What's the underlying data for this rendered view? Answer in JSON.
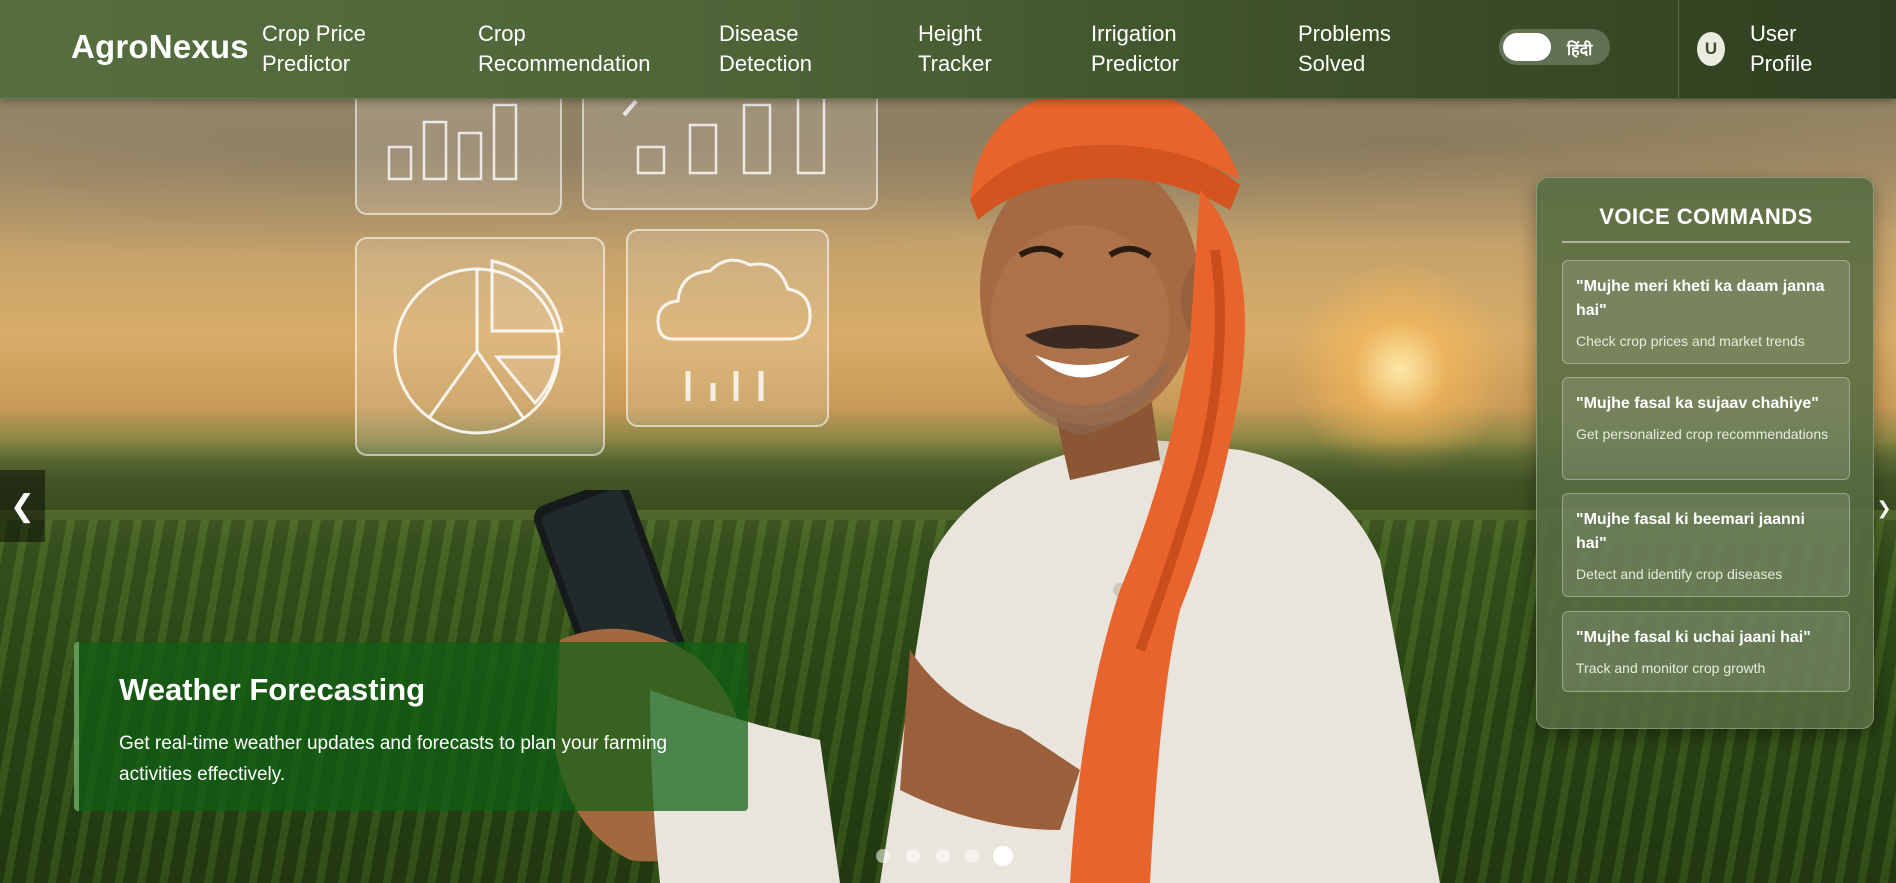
{
  "brand": {
    "name": "AgroNexus"
  },
  "nav": {
    "items": [
      {
        "label_line1": "Crop Price",
        "label_line2": "Predictor"
      },
      {
        "label_line1": "Crop",
        "label_line2": "Recommendation"
      },
      {
        "label_line1": "Disease",
        "label_line2": "Detection"
      },
      {
        "label_line1": "Height",
        "label_line2": "Tracker"
      },
      {
        "label_line1": "Irrigation",
        "label_line2": "Predictor"
      },
      {
        "label_line1": "Problems",
        "label_line2": "Solved"
      }
    ],
    "language_toggle": {
      "label": "हिंदी"
    },
    "profile": {
      "avatar_initial": "U",
      "label_line1": "User",
      "label_line2": "Profile"
    }
  },
  "slider": {
    "prev_glyph": "❮",
    "next_glyph": "❯",
    "caption": {
      "title": "Weather Forecasting",
      "text": "Get real-time weather updates and forecasts to plan your farming activities effectively."
    },
    "slide_count": 5,
    "active_index": 4
  },
  "voice_commands": {
    "title": "VOICE COMMANDS",
    "items": [
      {
        "phrase": "\"Mujhe meri kheti ka daam janna hai\"",
        "description": "Check crop prices and market trends"
      },
      {
        "phrase": "\"Mujhe fasal ka sujaav chahiye\"",
        "description": "Get personalized crop recommendations"
      },
      {
        "phrase": "\"Mujhe fasal ki beemari jaanni hai\"",
        "description": "Detect and identify crop diseases"
      },
      {
        "phrase": "\"Mujhe fasal ki uchai jaani hai\"",
        "description": "Track and monitor crop growth"
      }
    ]
  },
  "colors": {
    "nav_start": "#566e40",
    "nav_end": "#2f3f20",
    "caption_bg": "#0e5f14",
    "panel_bg": "#566c42",
    "turban": "#e8642c"
  },
  "icons": {
    "hero_icons": [
      "bar-chart-icon",
      "growth-chart-icon",
      "pie-chart-icon",
      "rain-cloud-icon"
    ]
  }
}
